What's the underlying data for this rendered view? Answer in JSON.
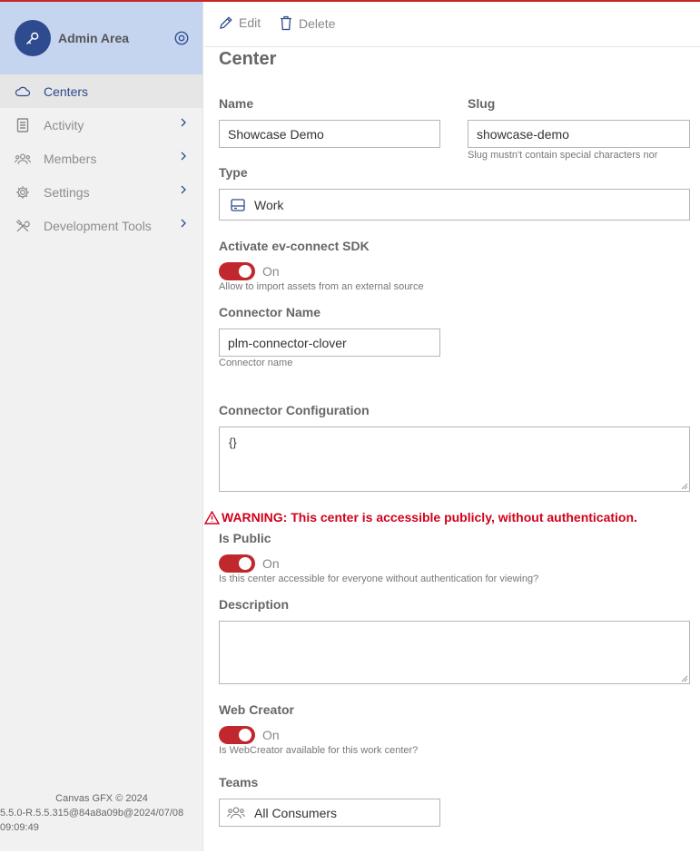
{
  "sidebar": {
    "title": "Admin Area",
    "items": [
      {
        "label": "Centers",
        "icon": "cloud-icon",
        "active": true
      },
      {
        "label": "Activity",
        "icon": "document-icon"
      },
      {
        "label": "Members",
        "icon": "people-icon"
      },
      {
        "label": "Settings",
        "icon": "gear-icon"
      },
      {
        "label": "Development Tools",
        "icon": "tools-icon"
      }
    ],
    "footer_copyright": "Canvas GFX © 2024",
    "footer_version_line1": "5.5.0-R.5.5.315@84a8a09b@2024/07/08",
    "footer_version_line2": "09:09:49"
  },
  "toolbar": {
    "edit_label": "Edit",
    "delete_label": "Delete"
  },
  "page_title": "Center",
  "form": {
    "name_label": "Name",
    "name_value": "Showcase Demo",
    "slug_label": "Slug",
    "slug_value": "showcase-demo",
    "slug_hint": "Slug mustn't contain special characters nor",
    "type_label": "Type",
    "type_value": "Work",
    "sdk_label": "Activate ev-connect SDK",
    "sdk_state": "On",
    "sdk_hint": "Allow to import assets from an external source",
    "connector_name_label": "Connector Name",
    "connector_name_value": "plm-connector-clover",
    "connector_name_hint": "Connector name",
    "connector_config_label": "Connector Configuration",
    "connector_config_value": "{}",
    "warning_text": "WARNING: This center is accessible publicly, without authentication.",
    "public_label": "Is Public",
    "public_state": "On",
    "public_hint": "Is this center accessible for everyone without authentication for viewing?",
    "description_label": "Description",
    "description_value": "",
    "webcreator_label": "Web Creator",
    "webcreator_state": "On",
    "webcreator_hint": "Is WebCreator available for this work center?",
    "teams_label": "Teams",
    "teams_value": "All Consumers"
  },
  "colors": {
    "accent": "#2d4b8e",
    "toggle_on": "#c0282d",
    "warning": "#d0021b",
    "sidebar_header": "#c5d4ef"
  }
}
